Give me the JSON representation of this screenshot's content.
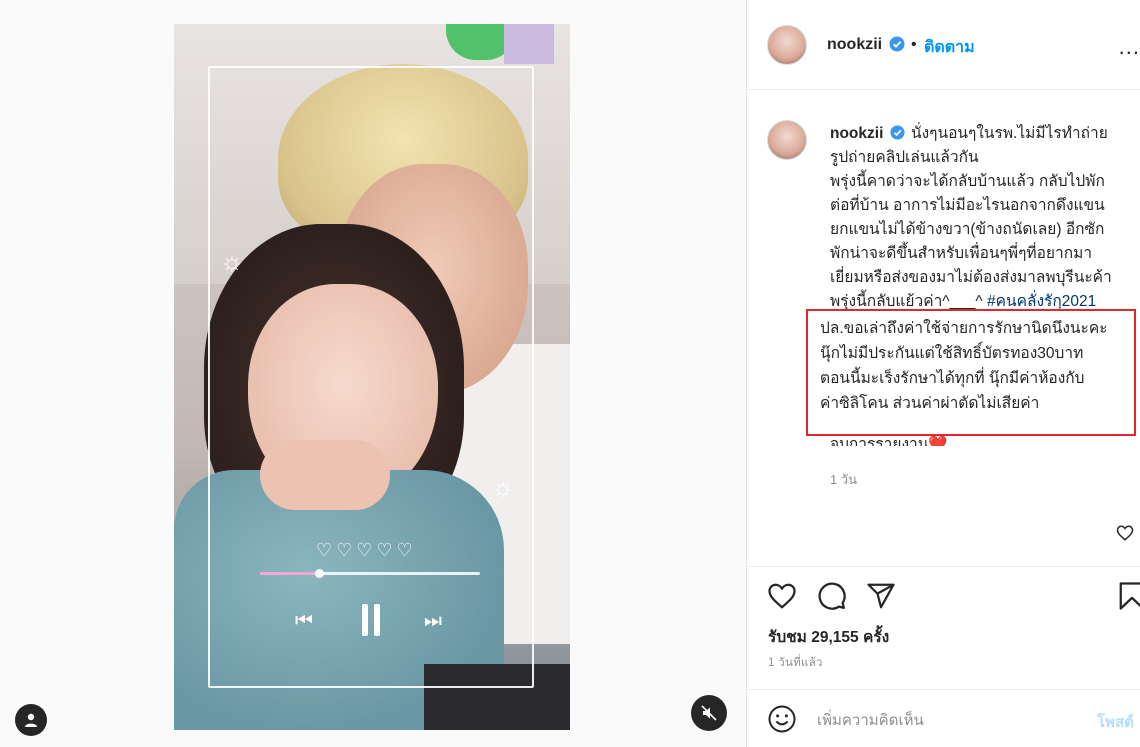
{
  "post": {
    "username": "nookzii",
    "separator": "•",
    "follow_label": "ติดตาม",
    "more_label": "...",
    "verified_icon": "verified-badge-icon",
    "accent_color": "#0095f6"
  },
  "caption": {
    "username": "nookzii",
    "lines": [
      "นั่งๆนอนๆในรพ.ไม่มีไรทำถ่าย",
      "รูปถ่ายคลิปเล่นแล้วกัน",
      "พรุ่งนี้คาดว่าจะได้กลับบ้านแล้ว กลับไปพัก",
      "ต่อที่บ้าน อาการไม่มีอะไรนอกจากดึงแขน",
      "ยกแขนไม่ได้ข้างขวา(ข้างถนัดเลย) อีกซัก",
      "พักน่าจะดีขึ้นสำหรับเพื่อนๆพี่ๆที่อยากมา",
      "เยี่ยมหรือส่งของมาไม่ต้องส่งมาลพบุรีนะค้า",
      "พรุ่งนี้กลับแย้วค่า^___^"
    ],
    "hashtag": "#คนคลั่งรักฺ2021",
    "highlight_lines": [
      "ปล.ขอเล่าถึงค่าใช้จ่ายการรักษานิดนึงนะคะ",
      "นุ๊กไม่มีประกันแต่ใช้สิทธิ์บัตรทอง30บาท",
      "ตอนนี้มะเร็งรักษาได้ทุกที่ นุ๊กมีค่าห้องกับ",
      "ค่าซิลิโคน ส่วนค่าผ่าตัดไม่เสียค่า"
    ],
    "cut_line": "จบการรายงาน❤️",
    "time": "1 วัน",
    "highlight_color": "#e0262e"
  },
  "video": {
    "hearts": "♡♡♡♡♡",
    "progress": 0.27,
    "prev_label": "⏮",
    "next_label": "⏭",
    "sparkle": "☼"
  },
  "actions": {
    "like_icon": "heart-icon",
    "comment_icon": "comment-icon",
    "share_icon": "share-icon",
    "save_icon": "bookmark-icon",
    "likes_prefix": "รับชม",
    "likes_count": "29,155",
    "likes_suffix": "ครั้ง",
    "posted": "1 วันที่แล้ว"
  },
  "comment": {
    "placeholder": "เพิ่มความคิดเห็น",
    "post_label": "โพสต์"
  }
}
